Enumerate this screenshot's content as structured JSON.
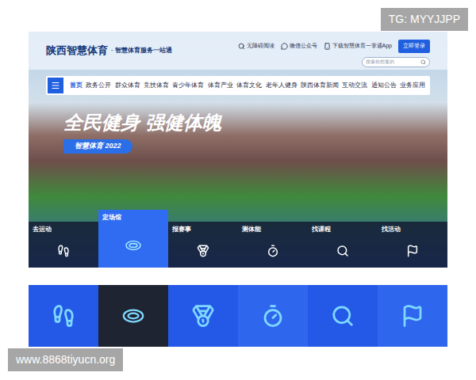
{
  "watermark_top": "TG: MYYJJPP",
  "watermark_bottom": "www.8868tiyucn.org",
  "header": {
    "logo": "陕西智慧体育",
    "slogan": "· 智慧体育服务一站通",
    "links": [
      "无障碍阅读",
      "微信公众号",
      "下载智慧体育一掌通App"
    ],
    "login_button": "立即登录",
    "search": {
      "placeholder": "搜索你想要的"
    }
  },
  "nav": [
    {
      "label": "首页",
      "selected": true
    },
    {
      "label": "政务公开",
      "selected": false
    },
    {
      "label": "群众体育",
      "selected": false
    },
    {
      "label": "竞技体育",
      "selected": false
    },
    {
      "label": "青少年体育",
      "selected": false
    },
    {
      "label": "体育产业",
      "selected": false
    },
    {
      "label": "体育文化",
      "selected": false
    },
    {
      "label": "老年人健身",
      "selected": false
    },
    {
      "label": "陕西体育新闻",
      "selected": false
    },
    {
      "label": "互动交流",
      "selected": false
    },
    {
      "label": "通知公告",
      "selected": false
    },
    {
      "label": "业务应用",
      "selected": false
    }
  ],
  "hero": {
    "headline": "全民健身 强健体魄",
    "badge": "智慧体育 2022"
  },
  "services": [
    {
      "label": "去运动",
      "selected": false
    },
    {
      "label": "定场馆",
      "selected": true
    },
    {
      "label": "报赛事",
      "selected": false
    },
    {
      "label": "测体能",
      "selected": false
    },
    {
      "label": "找课程",
      "selected": false
    },
    {
      "label": "找活动",
      "selected": false
    }
  ],
  "tiles": [
    {
      "selected": false
    },
    {
      "selected": true
    },
    {
      "selected": false
    },
    {
      "selected": false
    },
    {
      "selected": false
    },
    {
      "selected": false
    }
  ]
}
